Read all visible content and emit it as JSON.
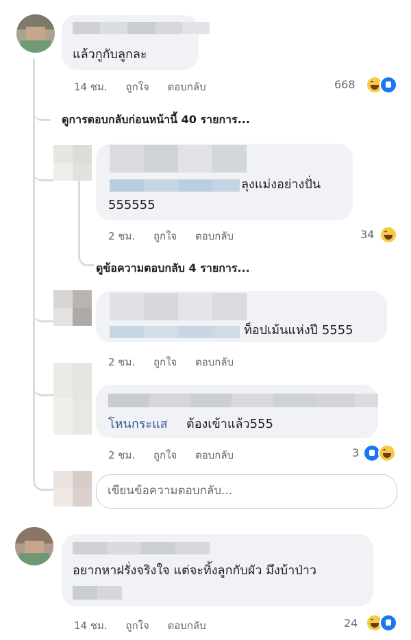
{
  "comment1": {
    "text": "แล้วกูกับลูกละ",
    "time": "14 ชม.",
    "like_label": "ถูกใจ",
    "reply_label": "ตอบกลับ",
    "reaction_count": "668",
    "reaction_icons": [
      "haha-icon",
      "like-icon"
    ]
  },
  "view_previous_replies": "ดูการตอบกลับก่อนหน้านี้ 40 รายการ...",
  "reply1": {
    "text_line1": "ลุงแม่งอย่างปั่น",
    "text_line2": "555555",
    "time": "2 ชม.",
    "like_label": "ถูกใจ",
    "reply_label": "ตอบกลับ",
    "reaction_count": "34",
    "reaction_icons": [
      "haha-icon"
    ]
  },
  "view_more_replies": "ดูข้อความตอบกลับ 4 รายการ...",
  "reply2": {
    "text": "ท็อปเม้นแห่งปี 5555",
    "time": "2 ชม.",
    "like_label": "ถูกใจ",
    "reply_label": "ตอบกลับ"
  },
  "reply3": {
    "mention": "โหนกระแส",
    "text": "ต้องเข้าแล้ว555",
    "time": "2 ชม.",
    "like_label": "ถูกใจ",
    "reply_label": "ตอบกลับ",
    "reaction_count": "3",
    "reaction_icons": [
      "like-icon",
      "haha-icon"
    ]
  },
  "reply_input": {
    "placeholder": "เขียนข้อความตอบกลับ..."
  },
  "comment2": {
    "text": "อยากหาฝรั่งจริงใจ แต่จะทิ้งลูกกับผัว มึงบ้าป่าว",
    "time": "14 ชม.",
    "like_label": "ถูกใจ",
    "reply_label": "ตอบกลับ",
    "reaction_count": "24",
    "reaction_icons": [
      "haha-icon",
      "like-icon"
    ]
  },
  "colors": {
    "bubble": "#f0f2f5",
    "meta_text": "#65676b",
    "mention": "#385898",
    "like_blue": "#1877f2",
    "haha_yellow": "#f7c94a"
  }
}
